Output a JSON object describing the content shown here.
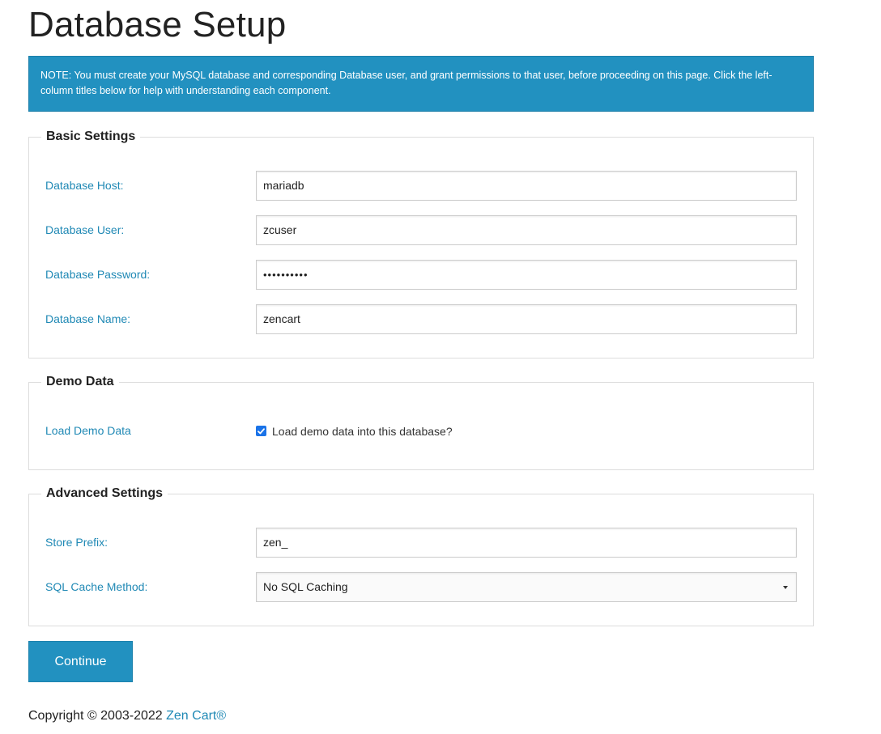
{
  "page": {
    "title": "Database Setup",
    "note": "NOTE: You must create your MySQL database and corresponding Database user, and grant permissions to that user, before proceeding on this page. Click the left-column titles below for help with understanding each component."
  },
  "basic_settings": {
    "legend": "Basic Settings",
    "host_label": "Database Host:",
    "host_value": "mariadb",
    "user_label": "Database User:",
    "user_value": "zcuser",
    "password_label": "Database Password:",
    "password_value": "••••••••••",
    "name_label": "Database Name:",
    "name_value": "zencart"
  },
  "demo_data": {
    "legend": "Demo Data",
    "label": "Load Demo Data",
    "checkbox_text": "Load demo data into this database?",
    "checked": true
  },
  "advanced_settings": {
    "legend": "Advanced Settings",
    "prefix_label": "Store Prefix:",
    "prefix_value": "zen_",
    "cache_label": "SQL Cache Method:",
    "cache_value": "No SQL Caching"
  },
  "actions": {
    "continue_label": "Continue"
  },
  "footer": {
    "copyright": "Copyright © 2003-2022 ",
    "link_text": "Zen Cart®"
  },
  "colors": {
    "accent": "#2291c0",
    "label_link": "#2089b5",
    "checkbox": "#1a73e8"
  }
}
